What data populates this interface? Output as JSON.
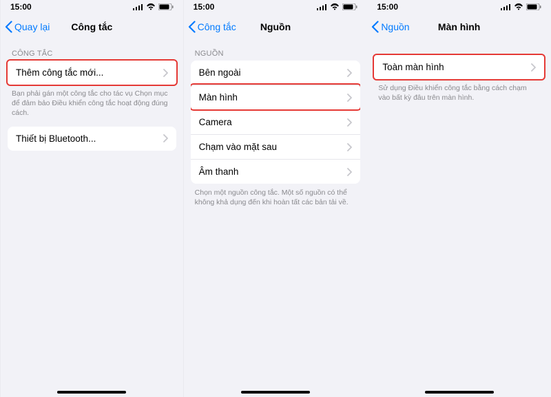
{
  "status": {
    "time": "15:00"
  },
  "s1": {
    "back": "Quay lại",
    "title": "Công tắc",
    "section": "CÔNG TẮC",
    "addNew": "Thêm công tắc mới...",
    "footer": "Bạn phải gán một công tắc cho tác vụ Chọn mục để đảm bảo Điều khiển công tắc hoạt động đúng cách.",
    "bluetooth": "Thiết bị Bluetooth..."
  },
  "s2": {
    "back": "Công tắc",
    "title": "Nguồn",
    "section": "NGUỒN",
    "items": {
      "0": "Bên ngoài",
      "1": "Màn hình",
      "2": "Camera",
      "3": "Chạm vào mặt sau",
      "4": "Âm thanh"
    },
    "footer": "Chọn một nguồn công tắc. Một số nguồn có thể không khả dụng đến khi hoàn tất các bản tải về."
  },
  "s3": {
    "back": "Nguồn",
    "title": "Màn hình",
    "item": "Toàn màn hình",
    "footer": "Sử dụng Điều khiển công tắc bằng cách chạm vào bất kỳ đâu trên màn hình."
  }
}
